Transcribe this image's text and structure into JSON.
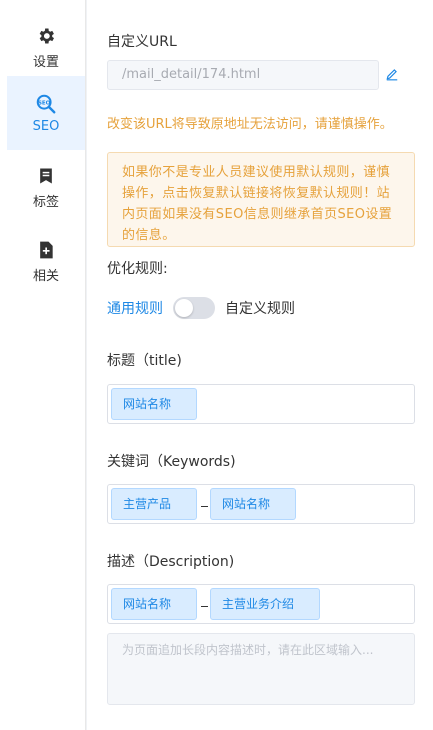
{
  "sidebar": {
    "items": [
      {
        "label": "设置",
        "icon": "gear-icon"
      },
      {
        "label": "SEO",
        "icon": "seo-search-icon",
        "icon_text": "SEO"
      },
      {
        "label": "标签",
        "icon": "bookmark-icon"
      },
      {
        "label": "相关",
        "icon": "file-add-icon"
      }
    ],
    "active_index": 1
  },
  "custom_url": {
    "label": "自定义URL",
    "value": "/mail_detail/174.html",
    "warning": "改变该URL将导致原地址无法访问，请谨慎操作。"
  },
  "notice": "如果你不是专业人员建议使用默认规则，谨慎操作，点击恢复默认链接将恢复默认规则！站内页面如果没有SEO信息则继承首页SEO设置的信息。",
  "rules": {
    "label": "优化规则:",
    "general": "通用规则",
    "custom": "自定义规则",
    "toggle_on": false
  },
  "title_field": {
    "label": "标题（title)",
    "tags": [
      "网站名称"
    ]
  },
  "keywords_field": {
    "label": "关键词（Keywords)",
    "tags": [
      "主营产品",
      "网站名称"
    ],
    "separator": "_"
  },
  "description_field": {
    "label": "描述（Description)",
    "tags": [
      "网站名称",
      "主营业务介绍"
    ],
    "separator": "_",
    "placeholder": "为页面追加长段内容描述时，请在此区域输入..."
  },
  "colors": {
    "accent": "#1e88e5",
    "warning": "#e6a23c",
    "tag_bg": "#d9ecff"
  }
}
